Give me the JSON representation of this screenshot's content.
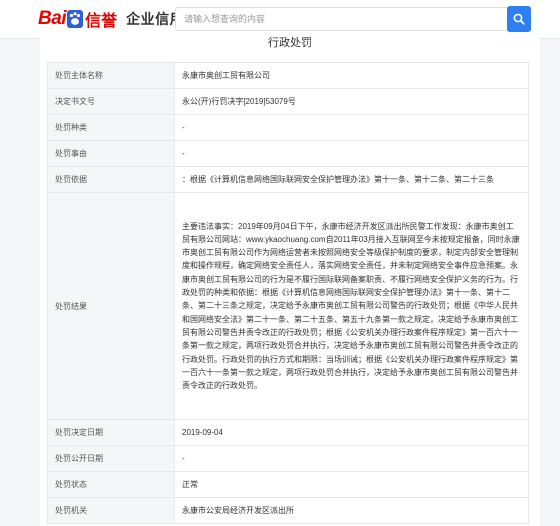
{
  "header": {
    "logo_bai": "Bai",
    "logo_xin": "信誉",
    "product_name": "企业信用",
    "search_placeholder": "请输入想查询的内容"
  },
  "page": {
    "title": "行政处罚"
  },
  "rows": [
    {
      "label": "处罚主体名称",
      "value": "永康市奥创工贸有限公司"
    },
    {
      "label": "决定书文号",
      "value": "永公(开)行罚决字[2019]53079号"
    },
    {
      "label": "处罚种类",
      "value": "-"
    },
    {
      "label": "处罚事由",
      "value": "-"
    },
    {
      "label": "处罚依据",
      "value": "：根据《计算机信息网络国际联网安全保护管理办法》第十一条、第十二条、第二十三条"
    },
    {
      "label": "处罚结果",
      "value": "主要违法事实：2019年09月04日下午，永康市经济开发区派出所民警工作发现：永康市奥创工贸有限公司网站：www.ykaochuang.com自2011年03月接入互联网至今未按规定报备，同时永康市奥创工贸有限公司作为网络运营者未按照网络安全等级保护制度的要求，制定内部安全管理制度和操作规程，确定网络安全责任人，落实网络安全责任，并未制定网络安全事件应急预案。永康市奥创工贸有限公司的行为是不履行国际联网备案职责、不履行网络安全保护义务的行为。行政处罚的种类和依据：根据《计算机信息网络国际联网安全保护管理办法》第十一条、第十二条、第二十三条之规定，决定给予永康市奥创工贸有限公司警告的行政处罚；根据《中华人民共和国网络安全法》第二十一条、第二十五条、第五十九条第一款之规定，决定给予永康市奥创工贸有限公司警告并责令改正的行政处罚；根据《公安机关办理行政案件程序规定》第一百六十一条第一款之规定，两项行政处罚合并执行，决定给予永康市奥创工贸有限公司警告并责令改正的行政处罚。行政处罚的执行方式和期限：当场训诫；根据《公安机关办理行政案件程序规定》第一百六十一条第一款之规定，两项行政处罚合并执行，决定给予永康市奥创工贸有限公司警告并责令改正的行政处罚。"
    },
    {
      "label": "处罚决定日期",
      "value": "2019-09-04"
    },
    {
      "label": "处罚公开日期",
      "value": "-"
    },
    {
      "label": "处罚状态",
      "value": "正常"
    },
    {
      "label": "处罚机关",
      "value": "永康市公安局经济开发区派出所"
    }
  ]
}
